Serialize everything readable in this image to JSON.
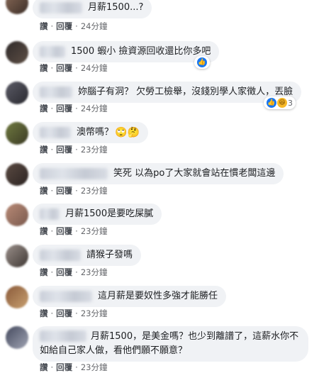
{
  "actions": {
    "like": "讚",
    "sep": "·",
    "reply": "回覆"
  },
  "comments": [
    {
      "text": "月薪1500...?",
      "time": "24分鐘",
      "name_w": 60,
      "avatar": [
        "#8a6b58",
        "#3c2e28"
      ]
    },
    {
      "text": "1500 蝦小 撿資源回收還比你多吧",
      "time": "24分鐘",
      "name_w": 36,
      "avatar": [
        "#2f2a2a",
        "#5e4f45"
      ],
      "reactions": {
        "icons": [
          "like-icon"
        ],
        "count": ""
      }
    },
    {
      "text": "妳腦子有洞？ 欠勞工檢舉，沒錢別學人家徵人，丟臉",
      "time": "24分鐘",
      "name_w": 46,
      "avatar": [
        "#5b5b66",
        "#2a2a30"
      ],
      "reactions": {
        "icons": [
          "like-icon",
          "haha-icon"
        ],
        "count": "3"
      }
    },
    {
      "text": "澳幣嗎？",
      "emoji": "🙄🤔",
      "time": "23分鐘",
      "name_w": 44,
      "avatar": [
        "#6f7a40",
        "#3b3a24"
      ]
    },
    {
      "text": "笑死 以為po了大家就會站在慣老闆這邊",
      "time": "23分鐘",
      "name_w": 96,
      "avatar": [
        "#5a4a42",
        "#2c2422"
      ]
    },
    {
      "text": "月薪1500是要吃屎膩",
      "time": "23分鐘",
      "name_w": 28,
      "avatar": [
        "#b88a76",
        "#7a5a4e"
      ]
    },
    {
      "text": "請猴子發嗎",
      "time": "23分鐘",
      "name_w": 58,
      "avatar": [
        "#9a8f8a",
        "#3f3834"
      ]
    },
    {
      "text": "這月薪是要奴性多強才能勝任",
      "time": "23分鐘",
      "name_w": 74,
      "avatar": [
        "#8a5a3a",
        "#c8a070"
      ]
    },
    {
      "text": "月薪1500，是美金嗎？也少到離譜了，這薪水你不",
      "text2": "如給自己家人做，看他們願不願意？",
      "time": "23分鐘",
      "name_w": 66,
      "avatar": [
        "#454a5e",
        "#a0a4b4"
      ]
    }
  ],
  "more_options_icon": "…"
}
